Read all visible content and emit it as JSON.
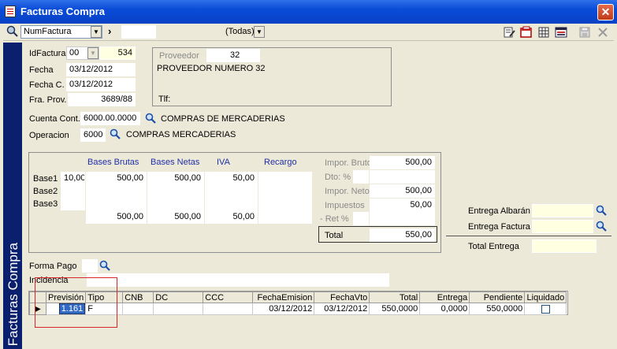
{
  "window": {
    "title": "Facturas Compra"
  },
  "toolbar": {
    "field_select": "NumFactura",
    "filter_value": "",
    "filter_select": "(Todas)"
  },
  "sidebar": {
    "label": "Facturas Compra"
  },
  "header": {
    "idfactura_label": "IdFactura",
    "serie": "00",
    "idfactura": "534",
    "fecha_label": "Fecha",
    "fecha": "03/12/2012",
    "fechac_label": "Fecha C.",
    "fechac": "03/12/2012",
    "fraprov_label": "Fra. Prov.",
    "fraprov": "3689/88"
  },
  "proveedor": {
    "label": "Proveedor",
    "code": "32",
    "name": "PROVEEDOR NUMERO 32",
    "tlf_label": "Tlf:"
  },
  "cuenta": {
    "label": "Cuenta Cont.",
    "code": "6000.00.0000",
    "desc": "COMPRAS DE MERCADERIAS"
  },
  "operacion": {
    "label": "Operacion",
    "code": "6000",
    "desc": "COMPRAS MERCADERIAS"
  },
  "bases": {
    "headers": [
      "Bases Brutas",
      "Bases Netas",
      "IVA",
      "Recargo"
    ],
    "rows": [
      {
        "label": "Base1",
        "pct": "10,00",
        "brutas": "500,00",
        "netas": "500,00",
        "iva": "50,00",
        "recargo": ""
      },
      {
        "label": "Base2",
        "pct": "",
        "brutas": "",
        "netas": "",
        "iva": "",
        "recargo": ""
      },
      {
        "label": "Base3",
        "pct": "",
        "brutas": "",
        "netas": "",
        "iva": "",
        "recargo": ""
      }
    ],
    "totals": {
      "brutas": "500,00",
      "netas": "500,00",
      "iva": "50,00",
      "recargo": ""
    }
  },
  "importes": {
    "bruto_label": "Impor. Bruto",
    "bruto": "500,00",
    "dto_label": "Dto: %",
    "dto": "",
    "neto_label": "Impor. Neto",
    "neto": "500,00",
    "impuestos_label": "Impuestos",
    "impuestos": "50,00",
    "ret_label": "- Ret %",
    "ret": "",
    "total_label": "Total",
    "total": "550,00"
  },
  "entregas": {
    "albaran_label": "Entrega Albarán",
    "albaran": "",
    "factura_label": "Entrega Factura",
    "factura": "",
    "total_label": "Total Entrega",
    "total": ""
  },
  "forma_pago": {
    "label": "Forma Pago",
    "value": ""
  },
  "incidencia": {
    "label": "Incidencia",
    "value": ""
  },
  "vencimientos": {
    "columns": [
      "Previsión",
      "Tipo",
      "CNB",
      "DC",
      "CCC",
      "FechaEmision",
      "FechaVto",
      "Total",
      "Entrega",
      "Pendiente",
      "Liquidado"
    ],
    "rows": [
      {
        "prevision": "1.161",
        "tipo": "F",
        "cnb": "",
        "dc": "",
        "ccc": "",
        "emision": "03/12/2012",
        "vto": "03/12/2012",
        "total": "550,0000",
        "entrega": "0,0000",
        "pendiente": "550,0000"
      }
    ]
  },
  "colors": {
    "title_bar": "#0a4bd8",
    "sidebar": "#0b1f6f",
    "accent_label": "#1f2fa8",
    "highlight": "#d9262b"
  }
}
